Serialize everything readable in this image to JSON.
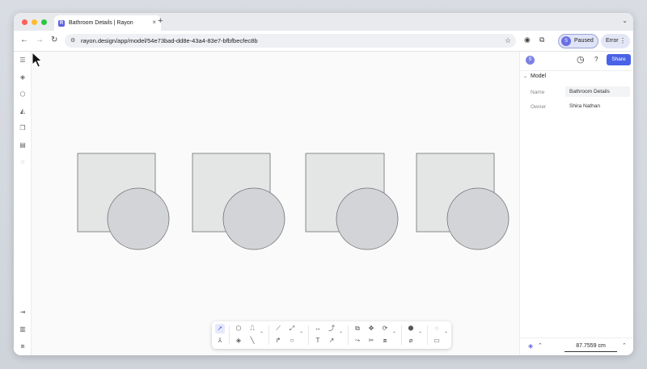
{
  "browser": {
    "tab_title": "Bathroom Details | Rayon",
    "tab_favicon_letter": "R",
    "tab_close": "×",
    "new_tab": "+",
    "tab_menu": "⌄",
    "back": "←",
    "forward": "→",
    "reload": "↻",
    "url": "rayon.design/app/model/54e73bad-dd8e-43a4-83e7-bfbfbecfec8b",
    "profile_label": "Paused",
    "profile_initial": "S",
    "error_label": "Error",
    "traffic_colors": [
      "#fe5f57",
      "#febc2e",
      "#28c840"
    ]
  },
  "left_toolbar": {
    "icons": [
      "menu-icon",
      "layers-icon",
      "cube-icon",
      "paint-bucket-icon",
      "pages-icon",
      "table-icon",
      "comment-icon",
      "collapse-icon",
      "library-icon",
      "assets-icon"
    ]
  },
  "right_panel": {
    "avatar_initial": "S",
    "help": "?",
    "share_label": "Share",
    "section_title": "Model",
    "properties": [
      {
        "label": "Name",
        "value": "Bathroom Details"
      },
      {
        "label": "Owner",
        "value": "Shira Nathan"
      }
    ],
    "scale_value": "87.7559 cm"
  },
  "canvas": {
    "shape_count": 4,
    "square_fill": "#e3e6e4",
    "circle_fill": "#d3d4d7",
    "stroke": "#707072"
  },
  "toolbar": {
    "active_tool": "select-tool",
    "text_tool_glyph": "T"
  },
  "colors": {
    "accent": "#4a62e8",
    "profile": "#6a6fe2"
  }
}
